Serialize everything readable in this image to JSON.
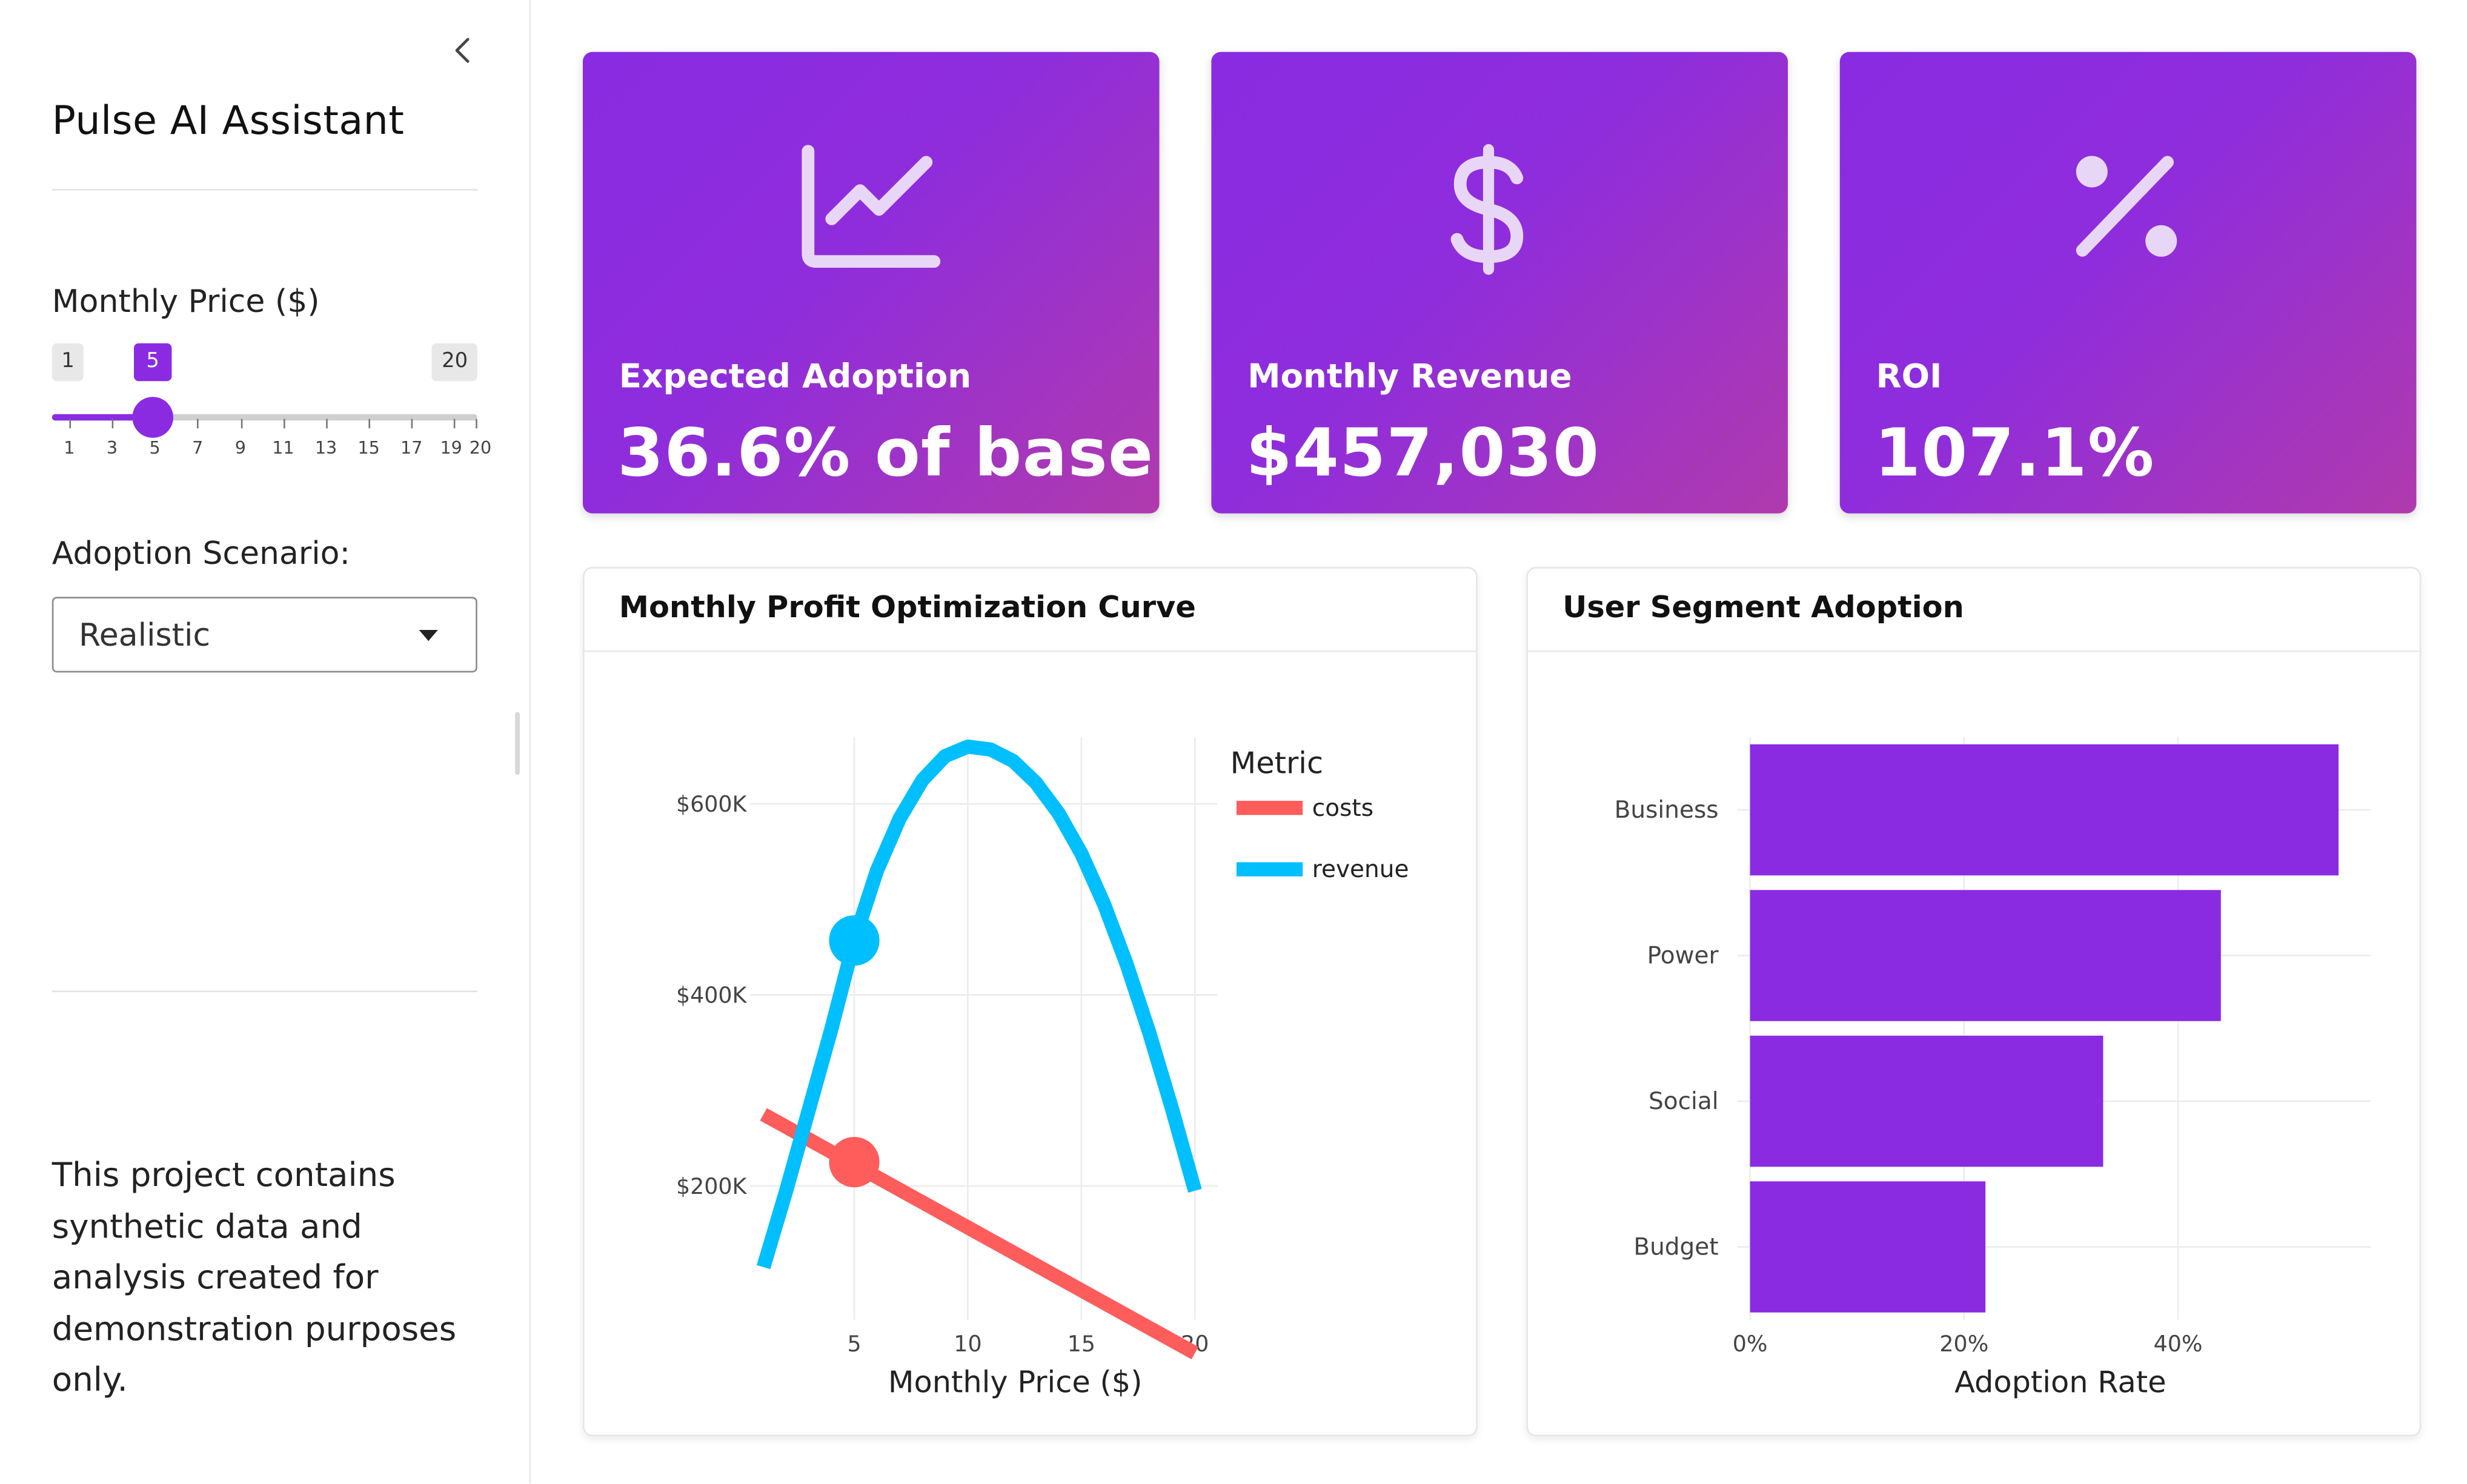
{
  "sidebar": {
    "title": "Pulse AI Assistant",
    "price_label": "Monthly Price ($)",
    "slider": {
      "min": "1",
      "max": "20",
      "value": "5",
      "ticks": [
        "1",
        "3",
        "5",
        "7",
        "9",
        "11",
        "13",
        "15",
        "17",
        "19",
        "20"
      ]
    },
    "scenario_label": "Adoption Scenario:",
    "scenario_value": "Realistic",
    "note": "This project contains synthetic data and analysis created for demonstration purposes only."
  },
  "kpis": [
    {
      "label": "Expected Adoption",
      "value": "36.6% of base",
      "icon": "chart-line-icon"
    },
    {
      "label": "Monthly Revenue",
      "value": "$457,030",
      "icon": "dollar-icon"
    },
    {
      "label": "ROI",
      "value": "107.1%",
      "icon": "percent-icon"
    }
  ],
  "colors": {
    "accent": "#8a2be2",
    "gradient_end": "#b03aad",
    "costs": "#ff5c5c",
    "revenue": "#00bfff"
  },
  "profit_card": {
    "title": "Monthly Profit Optimization Curve"
  },
  "segment_card": {
    "title": "User Segment Adoption"
  },
  "chart_data": [
    {
      "type": "line",
      "title": "Monthly Profit Optimization Curve",
      "xlabel": "Monthly Price ($)",
      "ylabel": "",
      "xlim": [
        0.4,
        21
      ],
      "ylim": [
        60000,
        670000
      ],
      "xticks": [
        5,
        10,
        15,
        20
      ],
      "xtick_labels": [
        "5",
        "10",
        "15",
        "20"
      ],
      "yticks": [
        200000,
        400000,
        600000
      ],
      "ytick_labels": [
        "$200K",
        "$400K",
        "$600K"
      ],
      "legend_title": "Metric",
      "legend_position": "top-right",
      "grid": true,
      "series": [
        {
          "name": "costs",
          "x": [
            1,
            20
          ],
          "y": [
            275000,
            25000
          ]
        },
        {
          "name": "revenue",
          "x": [
            1,
            2,
            3,
            4,
            5,
            6,
            7,
            8,
            9,
            10,
            11,
            12,
            13,
            14,
            15,
            16,
            17,
            18,
            19,
            20
          ],
          "y": [
            115000,
            195000,
            280000,
            365000,
            457030,
            530000,
            585000,
            625000,
            650000,
            660000,
            657000,
            645000,
            622000,
            590000,
            548000,
            495000,
            432000,
            360000,
            280000,
            195000
          ]
        }
      ],
      "highlight": {
        "x": 5,
        "costs": 225000,
        "revenue": 457030
      }
    },
    {
      "type": "bar",
      "orientation": "horizontal",
      "title": "User Segment Adoption",
      "xlabel": "Adoption Rate",
      "ylabel": "",
      "categories": [
        "Business",
        "Power",
        "Social",
        "Budget"
      ],
      "values": [
        0.55,
        0.44,
        0.33,
        0.22
      ],
      "xlim": [
        0,
        0.58
      ],
      "xticks": [
        0,
        0.2,
        0.4
      ],
      "xtick_labels": [
        "0%",
        "20%",
        "40%"
      ],
      "grid": true
    }
  ]
}
